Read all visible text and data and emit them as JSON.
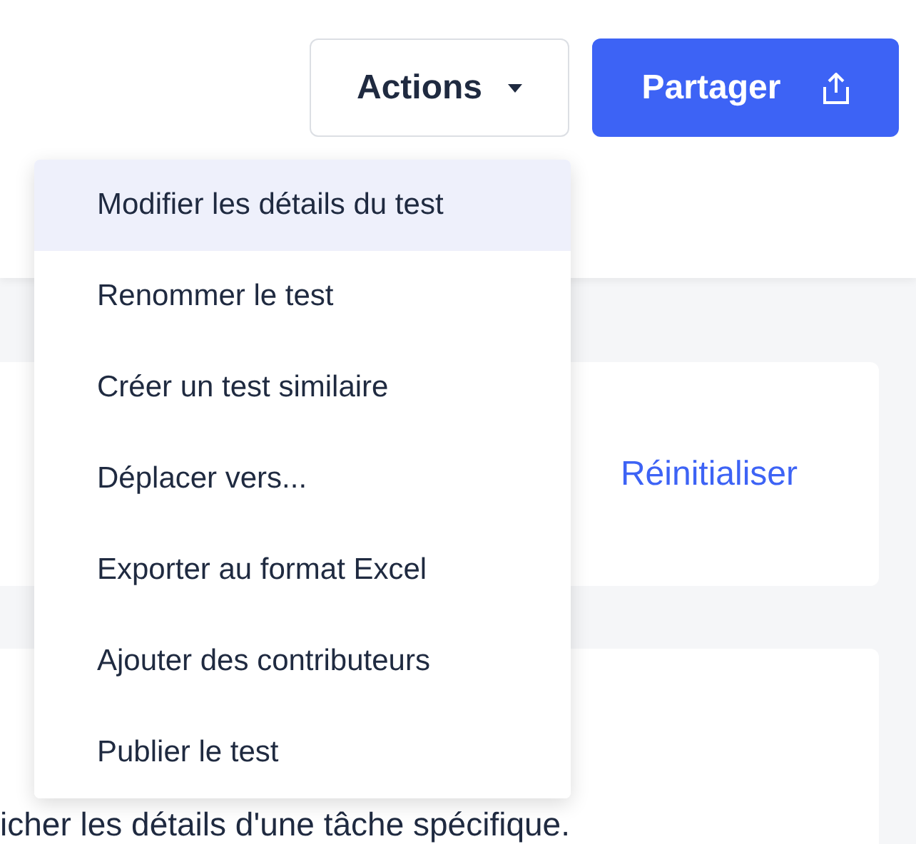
{
  "header": {
    "actions_button": "Actions",
    "share_button": "Partager"
  },
  "actions_menu": {
    "expanded": true,
    "items": [
      {
        "label": "Modifier les détails du test",
        "selected": true
      },
      {
        "label": "Renommer le test",
        "selected": false
      },
      {
        "label": "Créer un test similaire",
        "selected": false
      },
      {
        "label": "Déplacer vers...",
        "selected": false
      },
      {
        "label": "Exporter au format Excel",
        "selected": false
      },
      {
        "label": "Ajouter des contributeurs",
        "selected": false
      },
      {
        "label": "Publier le test",
        "selected": false
      }
    ]
  },
  "filter_card": {
    "reset_link": "Réinitialiser"
  },
  "tasks_card": {
    "description": "icher les détails d'une tâche spécifique."
  }
}
